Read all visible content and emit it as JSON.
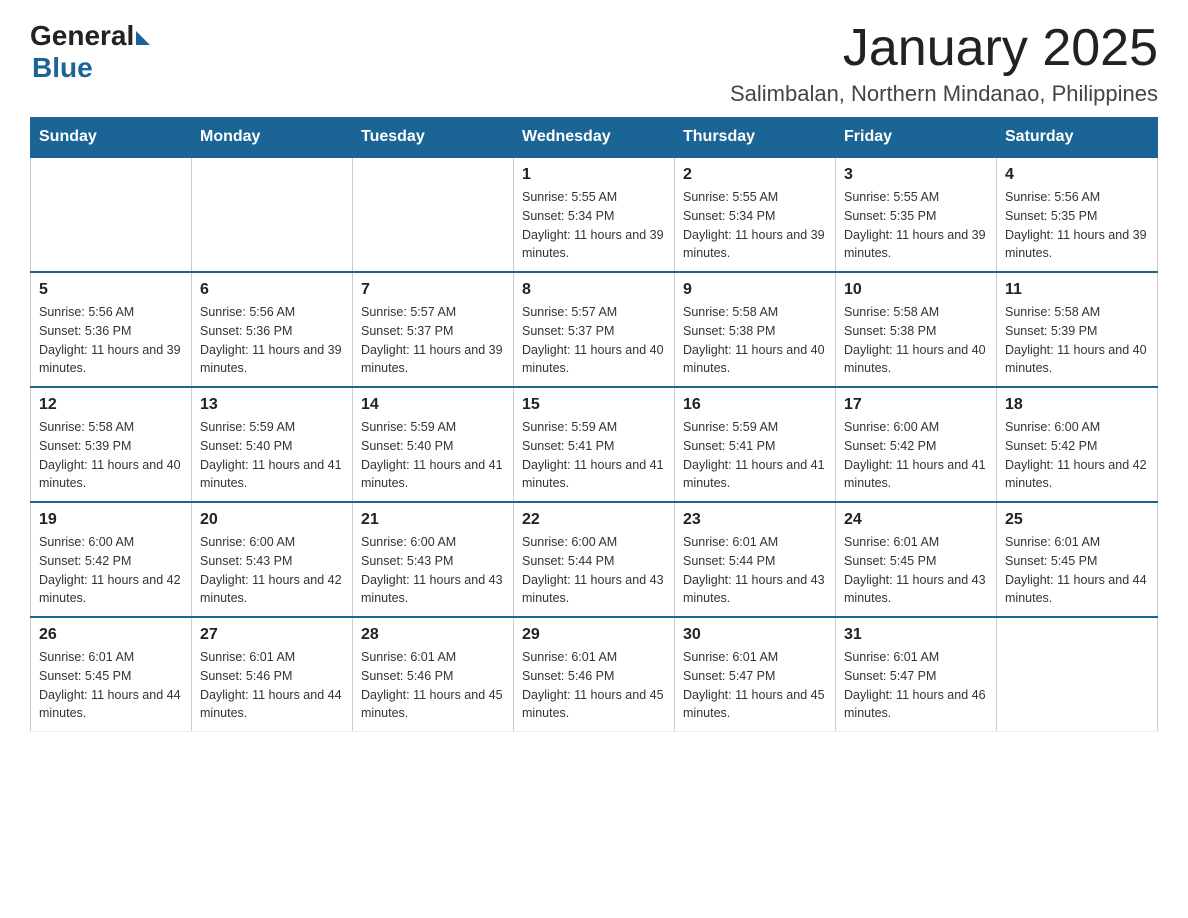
{
  "logo": {
    "general": "General",
    "blue": "Blue"
  },
  "header": {
    "month": "January 2025",
    "location": "Salimbalan, Northern Mindanao, Philippines"
  },
  "days_of_week": [
    "Sunday",
    "Monday",
    "Tuesday",
    "Wednesday",
    "Thursday",
    "Friday",
    "Saturday"
  ],
  "weeks": [
    [
      {
        "num": "",
        "info": ""
      },
      {
        "num": "",
        "info": ""
      },
      {
        "num": "",
        "info": ""
      },
      {
        "num": "1",
        "info": "Sunrise: 5:55 AM\nSunset: 5:34 PM\nDaylight: 11 hours and 39 minutes."
      },
      {
        "num": "2",
        "info": "Sunrise: 5:55 AM\nSunset: 5:34 PM\nDaylight: 11 hours and 39 minutes."
      },
      {
        "num": "3",
        "info": "Sunrise: 5:55 AM\nSunset: 5:35 PM\nDaylight: 11 hours and 39 minutes."
      },
      {
        "num": "4",
        "info": "Sunrise: 5:56 AM\nSunset: 5:35 PM\nDaylight: 11 hours and 39 minutes."
      }
    ],
    [
      {
        "num": "5",
        "info": "Sunrise: 5:56 AM\nSunset: 5:36 PM\nDaylight: 11 hours and 39 minutes."
      },
      {
        "num": "6",
        "info": "Sunrise: 5:56 AM\nSunset: 5:36 PM\nDaylight: 11 hours and 39 minutes."
      },
      {
        "num": "7",
        "info": "Sunrise: 5:57 AM\nSunset: 5:37 PM\nDaylight: 11 hours and 39 minutes."
      },
      {
        "num": "8",
        "info": "Sunrise: 5:57 AM\nSunset: 5:37 PM\nDaylight: 11 hours and 40 minutes."
      },
      {
        "num": "9",
        "info": "Sunrise: 5:58 AM\nSunset: 5:38 PM\nDaylight: 11 hours and 40 minutes."
      },
      {
        "num": "10",
        "info": "Sunrise: 5:58 AM\nSunset: 5:38 PM\nDaylight: 11 hours and 40 minutes."
      },
      {
        "num": "11",
        "info": "Sunrise: 5:58 AM\nSunset: 5:39 PM\nDaylight: 11 hours and 40 minutes."
      }
    ],
    [
      {
        "num": "12",
        "info": "Sunrise: 5:58 AM\nSunset: 5:39 PM\nDaylight: 11 hours and 40 minutes."
      },
      {
        "num": "13",
        "info": "Sunrise: 5:59 AM\nSunset: 5:40 PM\nDaylight: 11 hours and 41 minutes."
      },
      {
        "num": "14",
        "info": "Sunrise: 5:59 AM\nSunset: 5:40 PM\nDaylight: 11 hours and 41 minutes."
      },
      {
        "num": "15",
        "info": "Sunrise: 5:59 AM\nSunset: 5:41 PM\nDaylight: 11 hours and 41 minutes."
      },
      {
        "num": "16",
        "info": "Sunrise: 5:59 AM\nSunset: 5:41 PM\nDaylight: 11 hours and 41 minutes."
      },
      {
        "num": "17",
        "info": "Sunrise: 6:00 AM\nSunset: 5:42 PM\nDaylight: 11 hours and 41 minutes."
      },
      {
        "num": "18",
        "info": "Sunrise: 6:00 AM\nSunset: 5:42 PM\nDaylight: 11 hours and 42 minutes."
      }
    ],
    [
      {
        "num": "19",
        "info": "Sunrise: 6:00 AM\nSunset: 5:42 PM\nDaylight: 11 hours and 42 minutes."
      },
      {
        "num": "20",
        "info": "Sunrise: 6:00 AM\nSunset: 5:43 PM\nDaylight: 11 hours and 42 minutes."
      },
      {
        "num": "21",
        "info": "Sunrise: 6:00 AM\nSunset: 5:43 PM\nDaylight: 11 hours and 43 minutes."
      },
      {
        "num": "22",
        "info": "Sunrise: 6:00 AM\nSunset: 5:44 PM\nDaylight: 11 hours and 43 minutes."
      },
      {
        "num": "23",
        "info": "Sunrise: 6:01 AM\nSunset: 5:44 PM\nDaylight: 11 hours and 43 minutes."
      },
      {
        "num": "24",
        "info": "Sunrise: 6:01 AM\nSunset: 5:45 PM\nDaylight: 11 hours and 43 minutes."
      },
      {
        "num": "25",
        "info": "Sunrise: 6:01 AM\nSunset: 5:45 PM\nDaylight: 11 hours and 44 minutes."
      }
    ],
    [
      {
        "num": "26",
        "info": "Sunrise: 6:01 AM\nSunset: 5:45 PM\nDaylight: 11 hours and 44 minutes."
      },
      {
        "num": "27",
        "info": "Sunrise: 6:01 AM\nSunset: 5:46 PM\nDaylight: 11 hours and 44 minutes."
      },
      {
        "num": "28",
        "info": "Sunrise: 6:01 AM\nSunset: 5:46 PM\nDaylight: 11 hours and 45 minutes."
      },
      {
        "num": "29",
        "info": "Sunrise: 6:01 AM\nSunset: 5:46 PM\nDaylight: 11 hours and 45 minutes."
      },
      {
        "num": "30",
        "info": "Sunrise: 6:01 AM\nSunset: 5:47 PM\nDaylight: 11 hours and 45 minutes."
      },
      {
        "num": "31",
        "info": "Sunrise: 6:01 AM\nSunset: 5:47 PM\nDaylight: 11 hours and 46 minutes."
      },
      {
        "num": "",
        "info": ""
      }
    ]
  ]
}
